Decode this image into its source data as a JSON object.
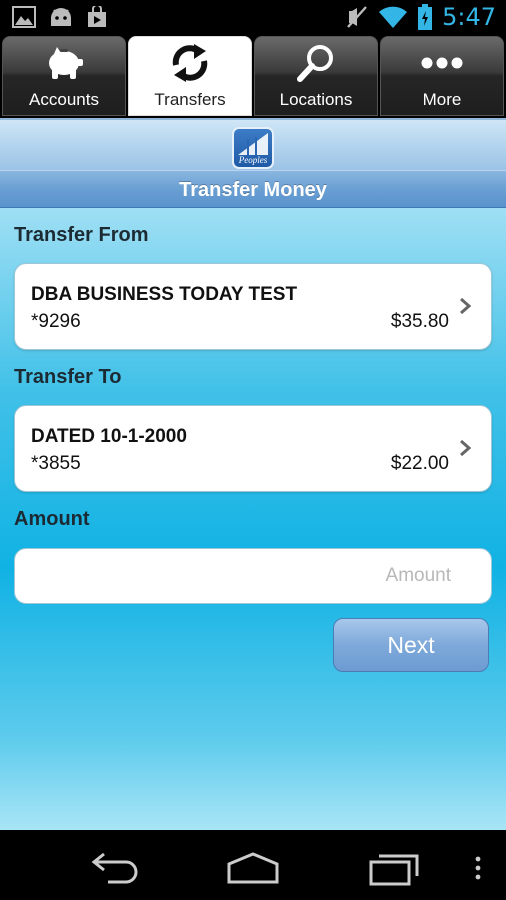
{
  "status_bar": {
    "time": "5:47",
    "left_icons": [
      "gallery-icon",
      "android-icon",
      "play-store-icon"
    ],
    "right_icons": [
      "mute-icon",
      "wifi-icon",
      "battery-icon"
    ]
  },
  "tabs": [
    {
      "label": "Accounts",
      "icon": "piggy-bank-icon",
      "active": false
    },
    {
      "label": "Transfers",
      "icon": "transfer-arrows-icon",
      "active": true
    },
    {
      "label": "Locations",
      "icon": "magnifier-icon",
      "active": false
    },
    {
      "label": "More",
      "icon": "more-dots-icon",
      "active": false
    }
  ],
  "header": {
    "logo_text": "Peoples",
    "title": "Transfer Money"
  },
  "form": {
    "from_label": "Transfer From",
    "from_account": {
      "name": "DBA BUSINESS TODAY TEST",
      "number": "*9296",
      "balance": "$35.80"
    },
    "to_label": "Transfer To",
    "to_account": {
      "name": "DATED 10-1-2000",
      "number": "*3855",
      "balance": "$22.00"
    },
    "amount_label": "Amount",
    "amount_placeholder": "Amount",
    "amount_value": "",
    "next_label": "Next"
  },
  "colors": {
    "accent": "#33b5e5",
    "title_bar": "#6a9fd3",
    "button": "#7ea9da"
  }
}
